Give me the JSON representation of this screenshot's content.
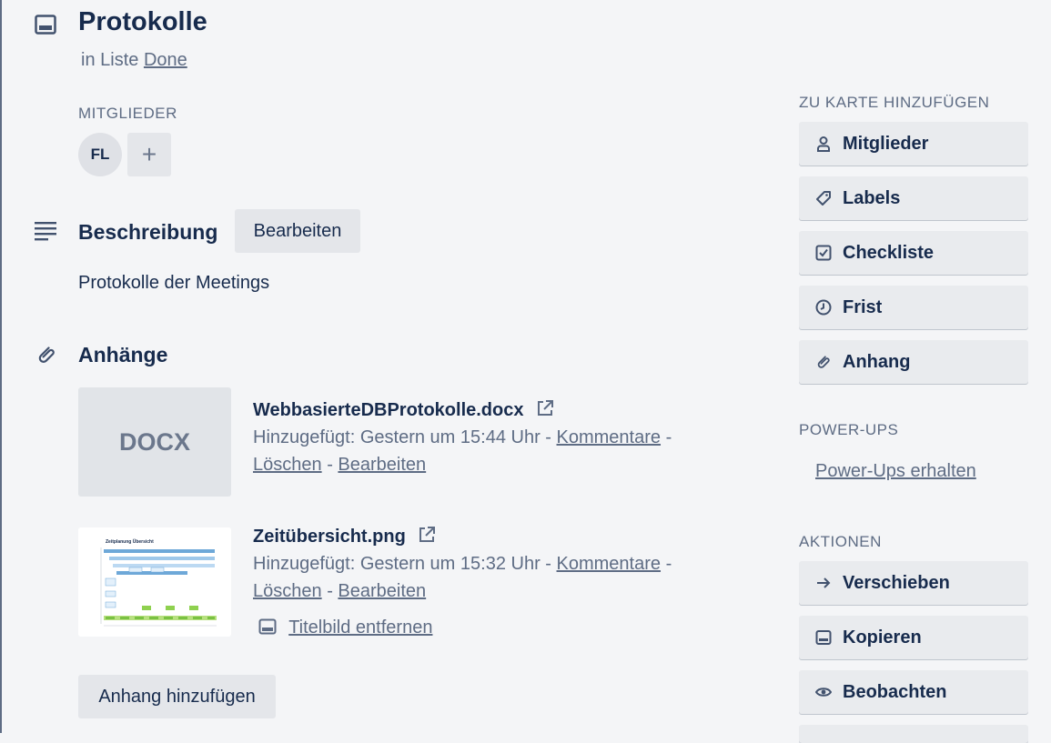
{
  "card": {
    "title": "Protokolle",
    "in_list_prefix": "in Liste",
    "list_name": "Done"
  },
  "members": {
    "label": "MITGLIEDER",
    "avatar_initials": "FL",
    "add_symbol": "+"
  },
  "description": {
    "heading": "Beschreibung",
    "edit_label": "Bearbeiten",
    "text": "Protokolle der Meetings"
  },
  "attachments": {
    "heading": "Anhänge",
    "items": [
      {
        "thumb_label": "DOCX",
        "name": "WebbasierteDBProtokolle.docx",
        "added": "Hinzugefügt: Gestern um 15:44 Uhr -",
        "comments": "Kommentare",
        "sep1": "-",
        "delete": "Löschen",
        "sep2": "-",
        "edit": "Bearbeiten"
      },
      {
        "thumb_title": "Zeitplanung Übersicht",
        "name": "Zeitübersicht.png",
        "added": "Hinzugefügt: Gestern um 15:32 Uhr -",
        "comments": "Kommentare",
        "sep1": "-",
        "delete": "Löschen",
        "sep2": "-",
        "edit": "Bearbeiten",
        "cover_action": "Titelbild entfernen"
      }
    ],
    "add_button": "Anhang hinzufügen"
  },
  "sidebar": {
    "add_heading": "ZU KARTE HINZUFÜGEN",
    "add_items": [
      {
        "label": "Mitglieder",
        "icon": "person-icon"
      },
      {
        "label": "Labels",
        "icon": "tag-icon"
      },
      {
        "label": "Checkliste",
        "icon": "checkbox-icon"
      },
      {
        "label": "Frist",
        "icon": "clock-icon"
      },
      {
        "label": "Anhang",
        "icon": "paperclip-icon"
      }
    ],
    "powerups_heading": "POWER-UPS",
    "powerups_link": "Power-Ups erhalten",
    "actions_heading": "AKTIONEN",
    "action_items": [
      {
        "label": "Verschieben",
        "icon": "arrow-right-icon"
      },
      {
        "label": "Kopieren",
        "icon": "card-icon"
      },
      {
        "label": "Beobachten",
        "icon": "eye-icon"
      }
    ]
  },
  "colors": {
    "background": "#f4f5f7",
    "text": "#172b4d",
    "muted": "#5e6c84",
    "button": "#e4e6ea"
  }
}
